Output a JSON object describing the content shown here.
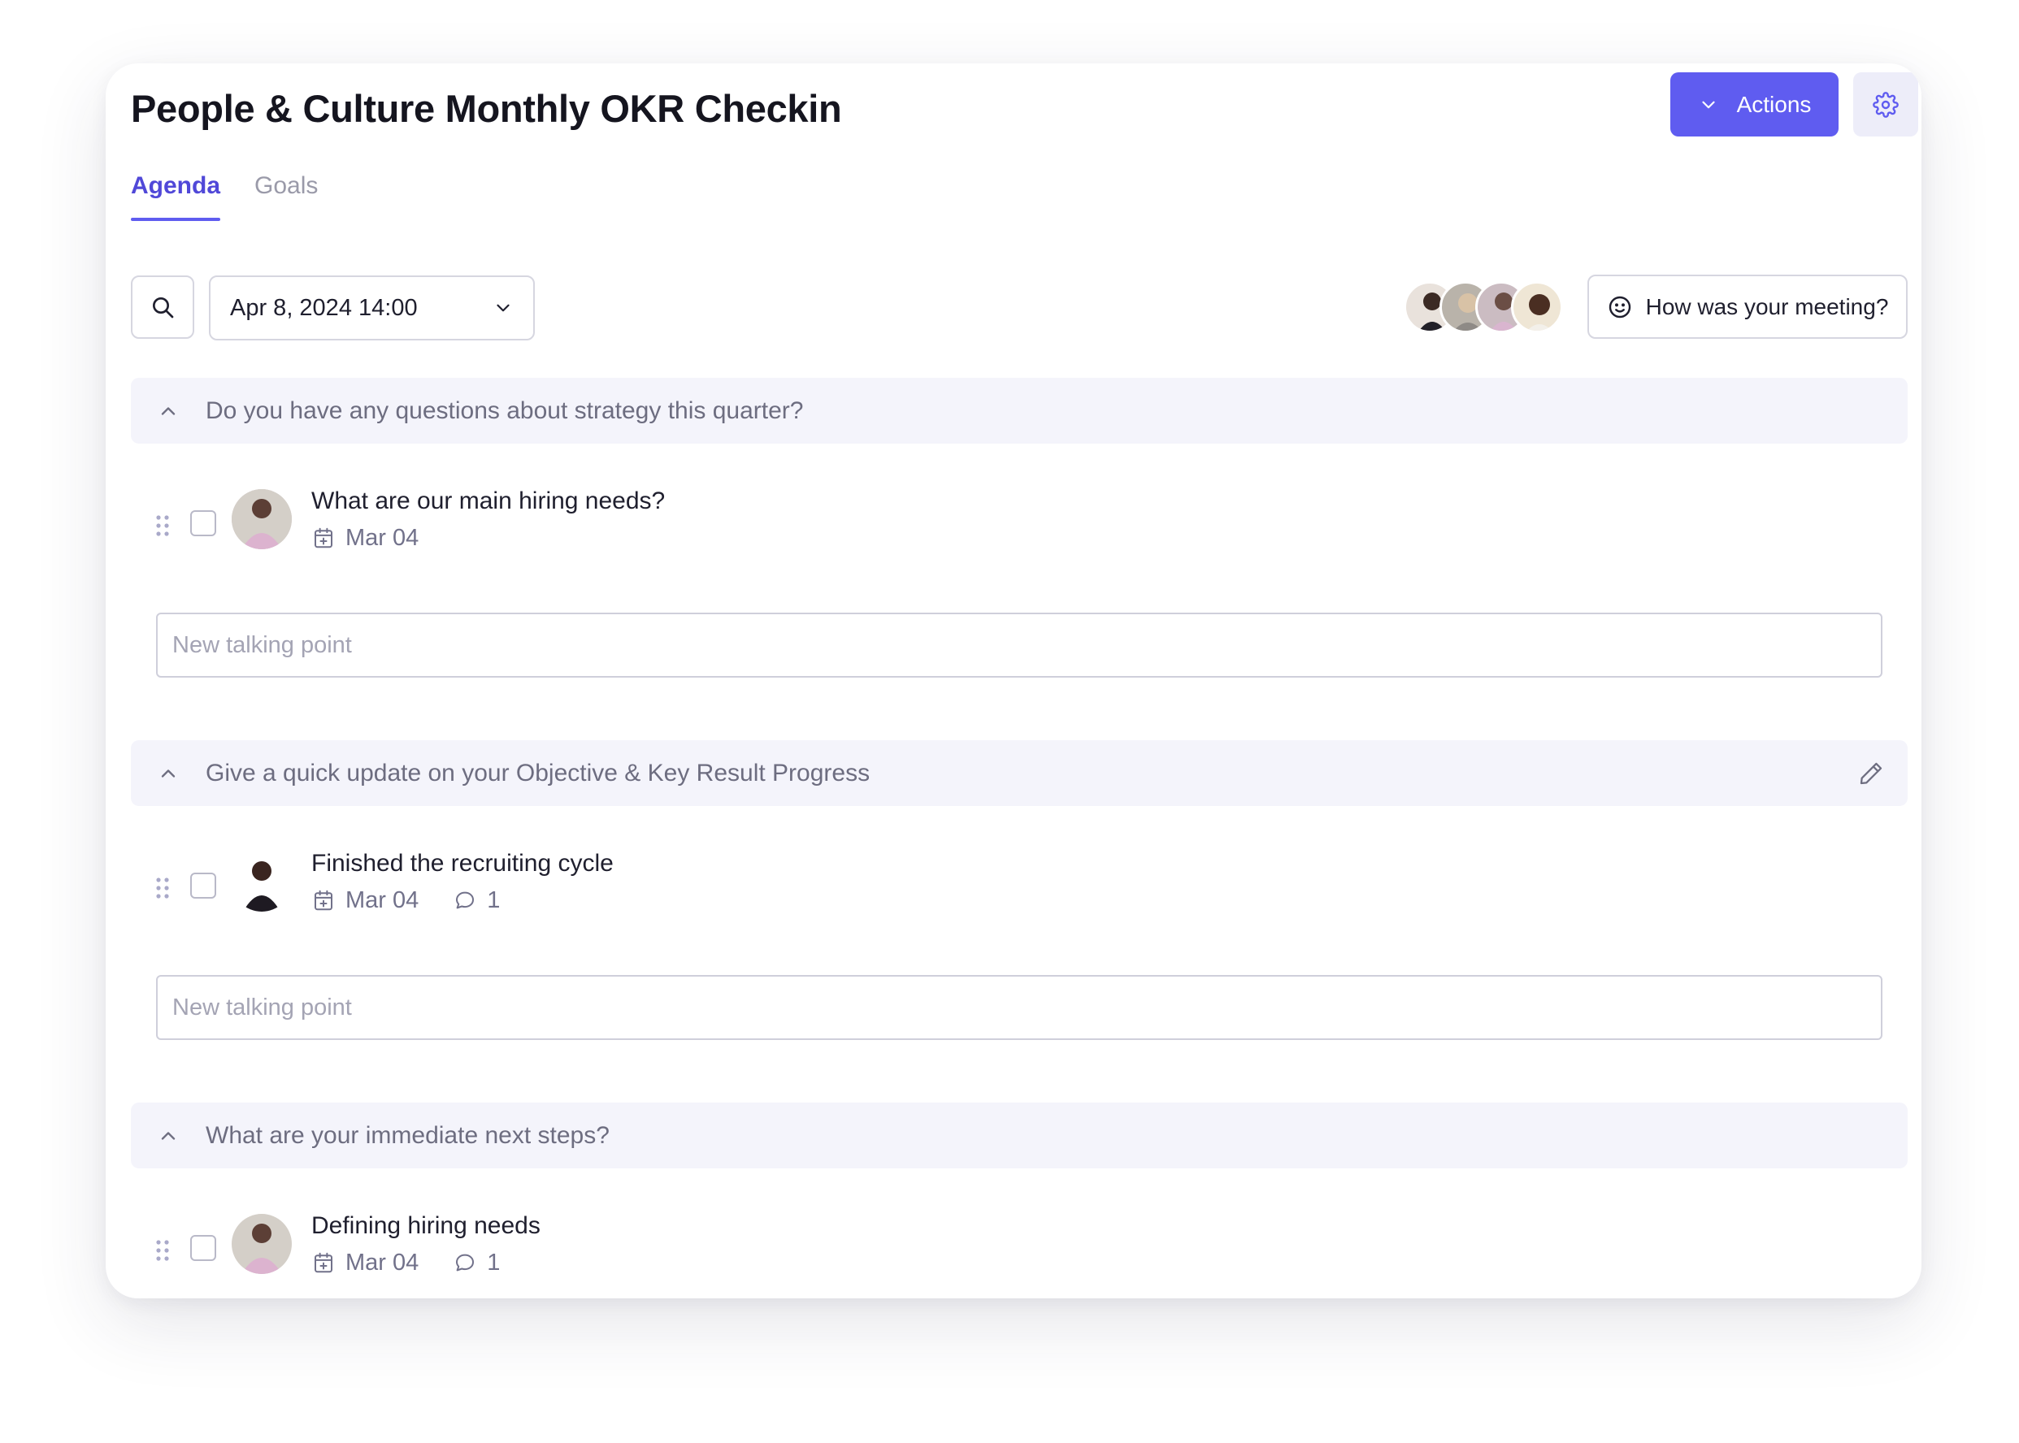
{
  "header": {
    "title": "People & Culture Monthly OKR Checkin",
    "actions_label": "Actions"
  },
  "tabs": [
    {
      "label": "Agenda",
      "active": true
    },
    {
      "label": "Goals",
      "active": false
    }
  ],
  "toolbar": {
    "date_value": "Apr 8, 2024 14:00",
    "feedback_label": "How was your meeting?"
  },
  "sections": [
    {
      "title": "Do you have any questions about strategy this quarter?",
      "items": [
        {
          "title": "What are our main hiring needs?",
          "date": "Mar 04"
        }
      ],
      "input_placeholder": "New talking point"
    },
    {
      "title": "Give a quick update on your Objective & Key Result Progress",
      "items": [
        {
          "title": "Finished the recruiting cycle",
          "date": "Mar 04",
          "comments": "1"
        }
      ],
      "input_placeholder": "New talking point"
    },
    {
      "title": "What are your immediate next steps?",
      "items": [
        {
          "title": "Defining hiring needs",
          "date": "Mar 04",
          "comments": "1"
        }
      ]
    }
  ],
  "colors": {
    "accent": "#5f5cf0",
    "section_bg": "#f4f4fb",
    "muted_text": "#71718a"
  }
}
